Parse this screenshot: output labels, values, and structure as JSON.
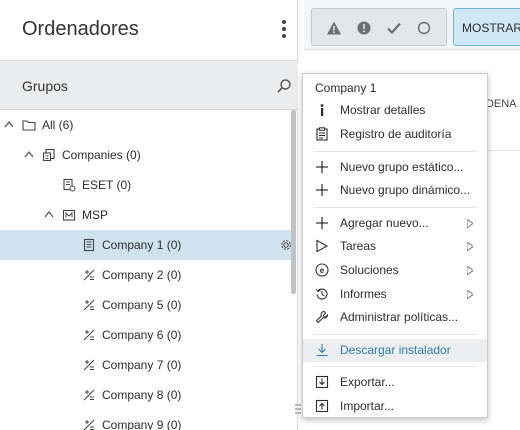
{
  "panel": {
    "title": "Ordenadores",
    "groups_label": "Grupos"
  },
  "tree": [
    {
      "label": "All (6)",
      "icon": "folder-icon"
    },
    {
      "label": "Companies (0)",
      "icon": "companies-icon"
    },
    {
      "label": "ESET (0)",
      "icon": "company-group-icon"
    },
    {
      "label": "MSP",
      "icon": "msp-icon"
    },
    {
      "label": "Company 1 (0)",
      "icon": "building-icon",
      "selected": true
    },
    {
      "label": "Company 2 (0)",
      "icon": "dynamic-group-icon"
    },
    {
      "label": "Company 5 (0)",
      "icon": "dynamic-group-icon"
    },
    {
      "label": "Company 6 (0)",
      "icon": "dynamic-group-icon"
    },
    {
      "label": "Company 7 (0)",
      "icon": "dynamic-group-icon"
    },
    {
      "label": "Company 8 (0)",
      "icon": "dynamic-group-icon"
    },
    {
      "label": "Company 9 (0)",
      "icon": "dynamic-group-icon"
    }
  ],
  "toolbar": {
    "show_label": "MOSTRAR S",
    "filters": [
      "warning-icon",
      "error-icon",
      "check-icon",
      "circle-icon"
    ]
  },
  "table": {
    "column_header": "RDENA"
  },
  "context_menu": {
    "title": "Company 1",
    "items": [
      {
        "label": "Mostrar detalles",
        "icon": "info-icon"
      },
      {
        "label": "Registro de auditoría",
        "icon": "audit-log-icon"
      },
      {
        "label": "Nuevo grupo estático...",
        "icon": "plus-icon"
      },
      {
        "label": "Nuevo grupo dinámico...",
        "icon": "plus-icon"
      },
      {
        "label": "Agregar nuevo...",
        "icon": "plus-icon",
        "submenu": true
      },
      {
        "label": "Tareas",
        "icon": "play-icon",
        "submenu": true
      },
      {
        "label": "Soluciones",
        "icon": "eset-icon",
        "submenu": true
      },
      {
        "label": "Informes",
        "icon": "history-icon",
        "submenu": true
      },
      {
        "label": "Administrar políticas...",
        "icon": "wrench-icon"
      },
      {
        "label": "Descargar instalador",
        "icon": "download-icon",
        "highlighted": true
      },
      {
        "label": "Exportar...",
        "icon": "export-icon"
      },
      {
        "label": "Importar...",
        "icon": "import-icon"
      }
    ]
  },
  "colors": {
    "selection": "#cfe3ee",
    "accent_blue": "#2c7fb0",
    "button_blue_bg": "#cfe8f3"
  }
}
